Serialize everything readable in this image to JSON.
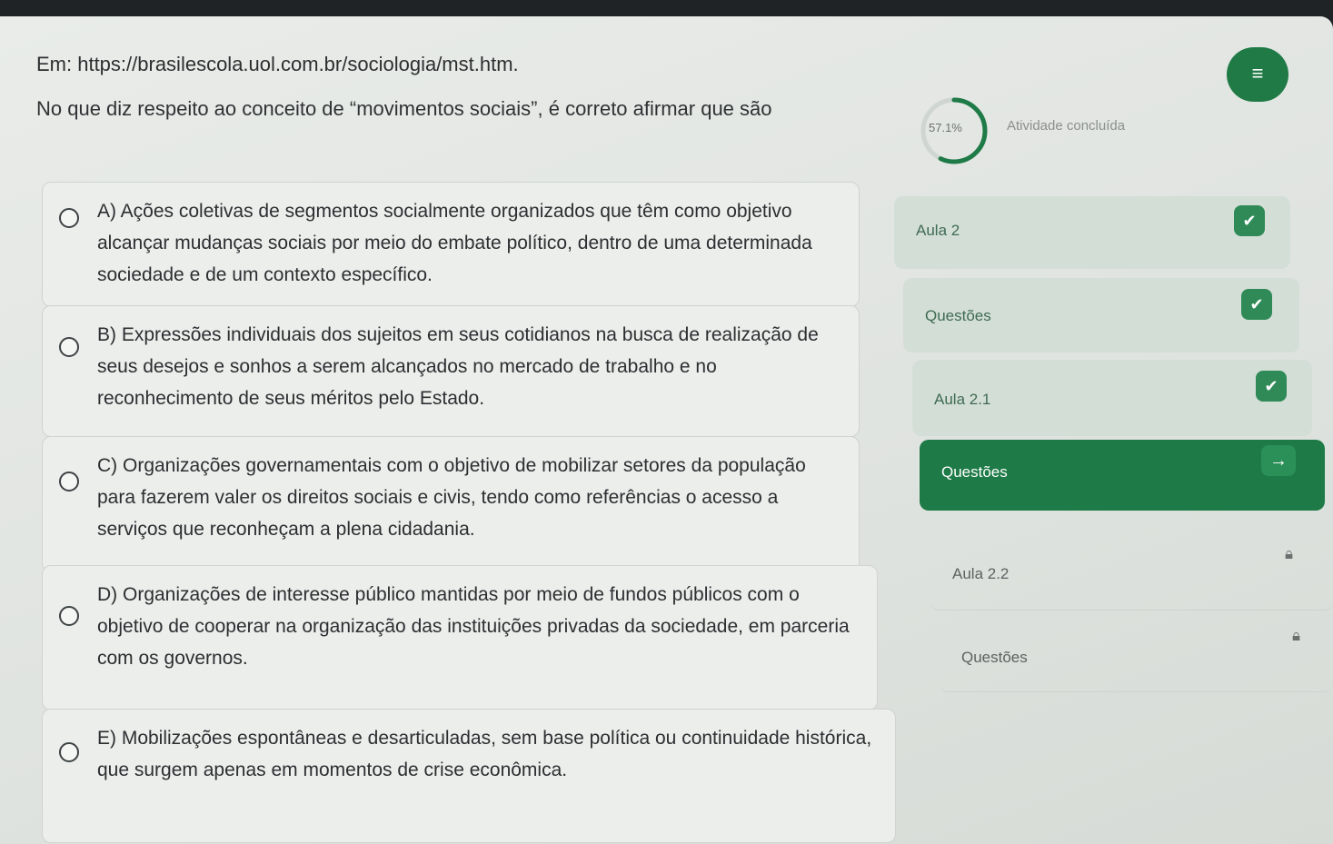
{
  "source_line": "Em: https://brasilescola.uol.com.br/sociologia/mst.htm.",
  "question": "No que diz respeito ao conceito de “movimentos sociais”, é correto afirmar que são",
  "options": [
    {
      "text": "A) Ações coletivas de segmentos socialmente organizados que têm como objetivo alcançar mudanças sociais por meio do embate político, dentro de uma determinada sociedade e de um contexto específico."
    },
    {
      "text": "B) Expressões individuais dos sujeitos em seus cotidianos na busca de realização de seus desejos e sonhos a serem alcançados no mercado de trabalho e no reconhecimento de seus méritos pelo Estado."
    },
    {
      "text": "C) Organizações governamentais com o objetivo de mobilizar setores da população para fazerem valer os direitos sociais e civis, tendo como referências o acesso a serviços que reconheçam a plena cidadania."
    },
    {
      "text": "D) Organizações de interesse público mantidas por meio de fundos públicos com o objetivo de cooperar na organização das instituições privadas da sociedade, em parceria com os governos."
    },
    {
      "text": "E) Mobilizações espontâneas e desarticuladas, sem base política ou continuidade histórica, que surgem apenas em momentos de crise econômica."
    }
  ],
  "progress": {
    "value_text": "57.1%",
    "value": 0.571,
    "status": "Atividade concluída"
  },
  "menu_icon": "menu-icon",
  "lessons": [
    {
      "label": "Aula 2",
      "state": "done"
    },
    {
      "label": "Questões",
      "state": "done"
    },
    {
      "label": "Aula 2.1",
      "state": "done"
    },
    {
      "label": "Questões",
      "state": "active"
    },
    {
      "label": "Aula 2.2",
      "state": "locked"
    },
    {
      "label": "Questões",
      "state": "locked"
    }
  ],
  "colors": {
    "accent": "#1e7a46",
    "done_bg": "#d3ded6"
  }
}
